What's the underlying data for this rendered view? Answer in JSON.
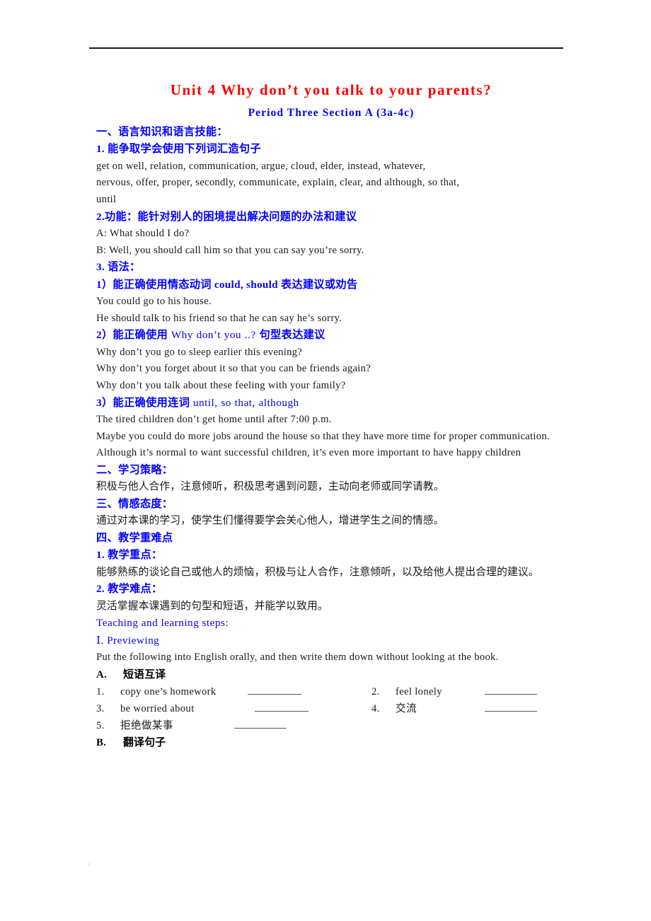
{
  "document": {
    "title": "Unit 4  Why don’t you talk to your parents?",
    "subtitle": "Period Three  Section A  (3a-4c)",
    "colors": {
      "title_red": "#ff0000",
      "heading_blue": "#0000ff",
      "body_black": "#1a1a1a",
      "blank_rule_gray": "#5a5a5a"
    },
    "sections": {
      "s1_heading": "一、语言知识和语言技能：",
      "s1_1_heading": "1. 能争取学会使用下列词汇造句子",
      "s1_1_body_line1": "get on well, relation, communication, argue, cloud, elder, instead, whatever,",
      "s1_1_body_line2": "nervous, offer, proper, secondly, communicate, explain, clear, and although, so that,",
      "s1_1_body_line3": "until",
      "s1_2_heading": "2.功能：能针对别人的困境提出解决问题的办法和建议",
      "s1_2_body_line1": "A: What should I do?",
      "s1_2_body_line2": "B: Well, you should call him so that you can say you’re sorry.",
      "s1_3_heading": "3. 语法：",
      "s1_3_1_heading": "1）能正确使用情态动词 could, should 表达建议或劝告",
      "s1_3_1_body_line1": "You could go to his house.",
      "s1_3_1_body_line2": "He should talk to his friend so that he can say he’s sorry.",
      "s1_3_2_heading_cn": "2）能正确使用 ",
      "s1_3_2_heading_en": "Why don’t you ..? ",
      "s1_3_2_heading_cn2": "句型表达建议",
      "s1_3_2_body_line1": "Why don’t you go to sleep earlier this evening?",
      "s1_3_2_body_line2": "Why don’t you forget about it so that you can be friends again?",
      "s1_3_2_body_line3": "Why don’t you talk about these feeling with your family?",
      "s1_3_3_heading_cn": "3）能正确使用连词 ",
      "s1_3_3_heading_en": "until, so that, although",
      "s1_3_3_body_line1": "The tired children don’t get home until after 7:00 p.m.",
      "s1_3_3_body_line2": "Maybe you could do more jobs around the house so that they have more time for proper communication.",
      "s1_3_3_body_line3": "Although it’s normal to want successful children, it’s even more important to have happy children",
      "s2_heading": " 二、学习策略：",
      "s2_body": " 积极与他人合作，注意倾听，积极思考遇到问题，主动向老师或同学请教。",
      "s3_heading": "三、情感态度：",
      "s3_body": "通过对本课的学习，使学生们懂得要学会关心他人，增进学生之间的情感。",
      "s4_heading": "四、教学重难点",
      "s4_1_heading": "1. 教学重点：",
      "s4_1_body": "能够熟练的谈论自己或他人的烦恼，积极与让人合作，注意倾听，以及给他人提出合理的建议。",
      "s4_2_heading": "2. 教学难点：",
      "s4_2_body": "灵活掌握本课遇到的句型和短语，并能学以致用。",
      "steps_heading": "Teaching and learning steps:",
      "step1_heading": " Ⅰ. Previewing",
      "step1_body": "Put the following into English orally, and then write them down without looking at the book."
    },
    "exercise_a": {
      "label": "A.",
      "title": "短语互译",
      "items": [
        {
          "num": "1.",
          "text": "copy one’s homework"
        },
        {
          "num": "2.",
          "text": "feel lonely"
        },
        {
          "num": "3.",
          "text": "be worried about"
        },
        {
          "num": "4.",
          "text": "交流"
        },
        {
          "num": "5.",
          "text": "拒绝做某事"
        }
      ]
    },
    "exercise_b": {
      "label": "B.",
      "title": "翻译句子"
    }
  }
}
